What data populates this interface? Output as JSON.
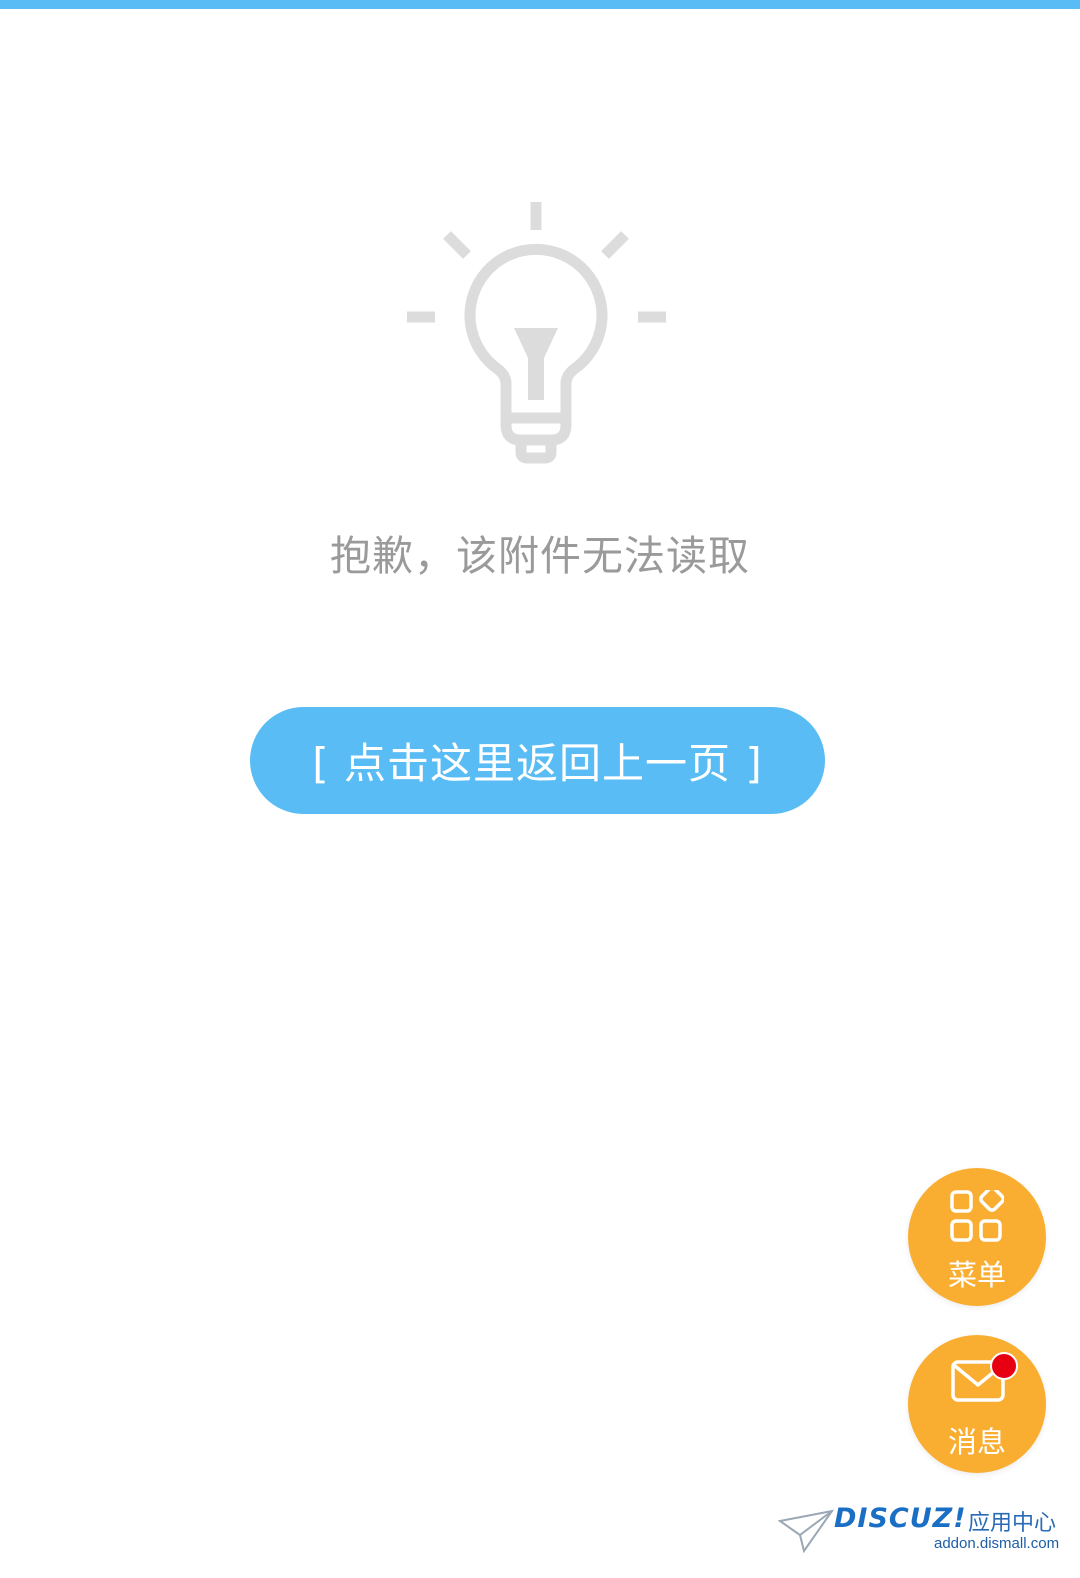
{
  "message": {
    "text": "抱歉，该附件无法读取"
  },
  "back_button": {
    "label": "[ 点击这里返回上一页 ]"
  },
  "fab": {
    "menu_label": "菜单",
    "message_label": "消息",
    "has_unread": true
  },
  "watermark": {
    "logo": "DISCUZ!",
    "center": "应用中心",
    "url": "addon.dismall.com"
  },
  "colors": {
    "top_bar": "#59bcf5",
    "button": "#59bcf5",
    "fab": "#f9ae32",
    "badge": "#e60012",
    "icon_gray": "#dcdcdc",
    "text_gray": "#9a9a9a"
  }
}
